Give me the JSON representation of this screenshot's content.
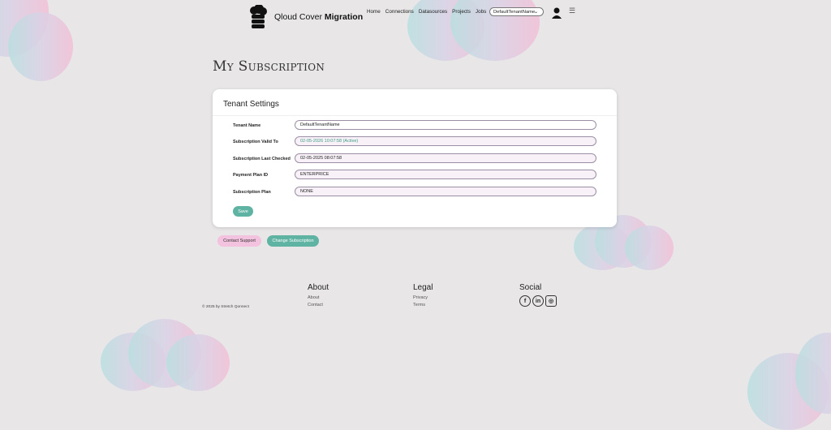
{
  "header": {
    "logo_text_regular": "Qloud Cover",
    "logo_text_bold": "Migration",
    "nav": [
      "Home",
      "Connections",
      "Datasources",
      "Projects",
      "Jobs"
    ],
    "tenant_selected": "DefaultTenantName"
  },
  "page": {
    "title": "My Subscription"
  },
  "card": {
    "title": "Tenant Settings",
    "rows": [
      {
        "label": "Tenant Name",
        "value": "DefaultTenantName"
      },
      {
        "label": "Subscription Valid To",
        "value": "02-05-2026 10:07:58 (Active)"
      },
      {
        "label": "Subscription Last Checked",
        "value": "02-05-2025 08:07:58"
      },
      {
        "label": "Payment Plan ID",
        "value": "ENTERPRICE"
      },
      {
        "label": "Subscription Plan",
        "value": "NONE"
      }
    ],
    "save_label": "Save"
  },
  "actions": {
    "support_label": "Contact Support",
    "change_label": "Change Subscription"
  },
  "footer": {
    "copyright": "© 2025 by Stretch Qonnect",
    "about": {
      "heading": "About",
      "links": [
        "About",
        "Contact"
      ]
    },
    "legal": {
      "heading": "Legal",
      "links": [
        "Privacy",
        "Terms"
      ]
    },
    "social": {
      "heading": "Social",
      "icons": [
        "facebook-icon",
        "linkedin-icon",
        "instagram-icon"
      ]
    }
  },
  "colors": {
    "accent": "#5fb3a2",
    "pink": "#f3c2de",
    "active_text": "#3e9a84"
  }
}
